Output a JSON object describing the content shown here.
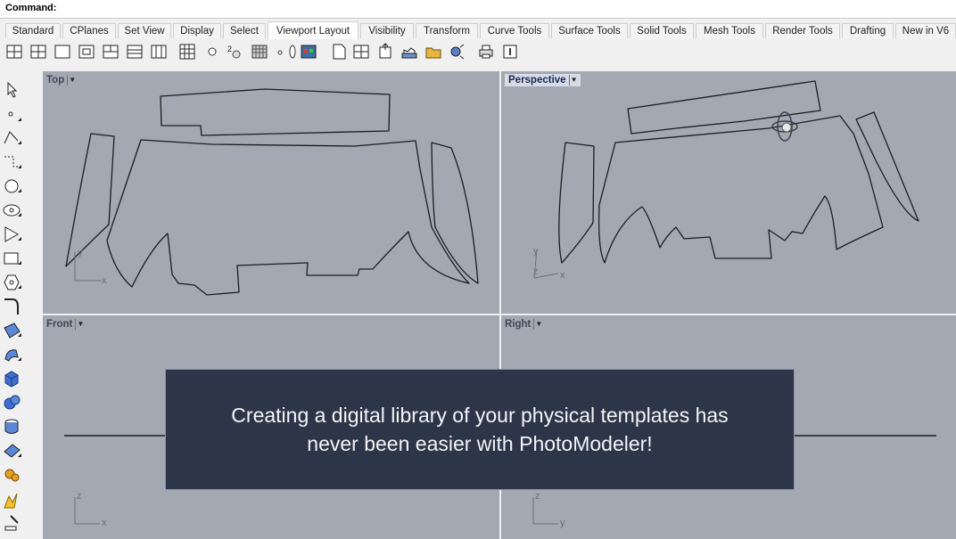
{
  "command": {
    "label": "Command:",
    "value": ""
  },
  "tabs": [
    {
      "label": "Standard"
    },
    {
      "label": "CPlanes"
    },
    {
      "label": "Set View"
    },
    {
      "label": "Display"
    },
    {
      "label": "Select"
    },
    {
      "label": "Viewport Layout",
      "active": true
    },
    {
      "label": "Visibility"
    },
    {
      "label": "Transform"
    },
    {
      "label": "Curve Tools"
    },
    {
      "label": "Surface Tools"
    },
    {
      "label": "Solid Tools"
    },
    {
      "label": "Mesh Tools"
    },
    {
      "label": "Render Tools"
    },
    {
      "label": "Drafting"
    },
    {
      "label": "New in V6"
    }
  ],
  "toolbar_icons": [
    "single-viewport-icon",
    "four-viewports-icon",
    "maximize-viewport-icon",
    "new-viewport-icon",
    "split-horizontal-icon",
    "split-vertical-icon",
    "split-grid-icon",
    "layout-grid-icon",
    "zoom-icon",
    "named-view-icon",
    "grid-icon",
    "small-dot-icon",
    "ellipse-icon",
    "render-preview-icon",
    "page-layout-icon",
    "detail-view-icon",
    "layout-export-icon",
    "floor-plan-icon",
    "open-folder-icon",
    "camera-options-icon",
    "print-icon",
    "properties-icon"
  ],
  "sidebar_icons": [
    "select-arrow-icon",
    "point-icon",
    "polyline-icon",
    "curve-icon",
    "circle-icon",
    "ellipse-icon",
    "polygon-icon",
    "rectangle-icon",
    "hexagon-icon",
    "fillet-icon",
    "surface-icon",
    "sweep-icon",
    "box-solid-icon",
    "sphere-union-icon",
    "cylinder-icon",
    "plane-surface-icon",
    "gear-transform-icon",
    "explode-icon",
    "trim-icon"
  ],
  "viewports": {
    "top": {
      "title": "Top",
      "axis_y": "y",
      "axis_x": "x"
    },
    "perspective": {
      "title": "Perspective",
      "axis_y": "y",
      "axis_x": "x",
      "axis_z": "z"
    },
    "front": {
      "title": "Front",
      "axis_y": "z",
      "axis_x": "x"
    },
    "right": {
      "title": "Right",
      "axis_y": "z",
      "axis_x": "y"
    }
  },
  "overlay": {
    "line1": "Creating a digital library of your physical templates has",
    "line2": "never been easier with PhotoModeler!"
  },
  "colors": {
    "viewport_bg": "#a3a9b3",
    "overlay_bg": "#2d3648",
    "curve": "#1b1d22"
  }
}
